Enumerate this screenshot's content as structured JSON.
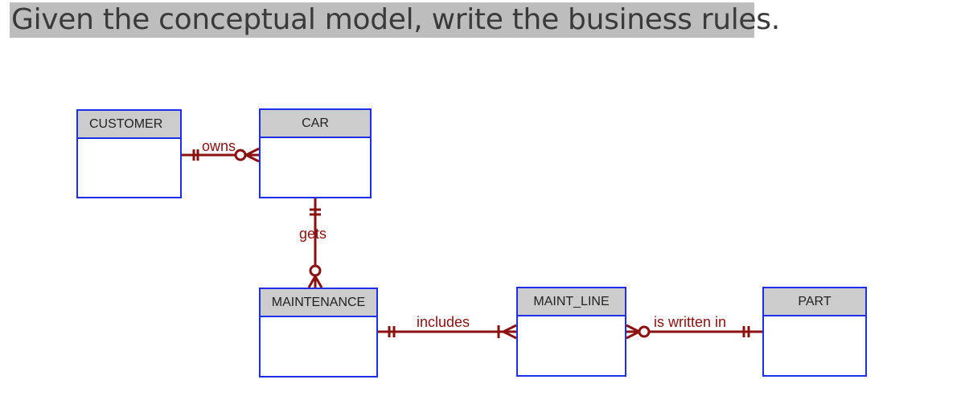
{
  "prompt": "Given the conceptual model, write the business rules.",
  "colors": {
    "entity_border": "#1f2fe8",
    "entity_header": "#cccccc",
    "relationship": "#8b1010",
    "title_bg": "#bdbdbd"
  },
  "entities": {
    "customer": {
      "name": "CUSTOMER"
    },
    "car": {
      "name": "CAR"
    },
    "maintenance": {
      "name": "MAINTENANCE"
    },
    "maint_line": {
      "name": "MAINT_LINE"
    },
    "part": {
      "name": "PART"
    }
  },
  "relationships": [
    {
      "label": "owns",
      "from": "CUSTOMER",
      "from_cardinality": "exactly one",
      "to": "CAR",
      "to_cardinality": "zero or many"
    },
    {
      "label": "gets",
      "from": "CAR",
      "from_cardinality": "exactly one",
      "to": "MAINTENANCE",
      "to_cardinality": "zero or many"
    },
    {
      "label": "includes",
      "from": "MAINTENANCE",
      "from_cardinality": "exactly one",
      "to": "MAINT_LINE",
      "to_cardinality": "one or many"
    },
    {
      "label": "is written in",
      "from": "PART",
      "from_cardinality": "exactly one",
      "to": "MAINT_LINE",
      "to_cardinality": "zero or many"
    }
  ]
}
